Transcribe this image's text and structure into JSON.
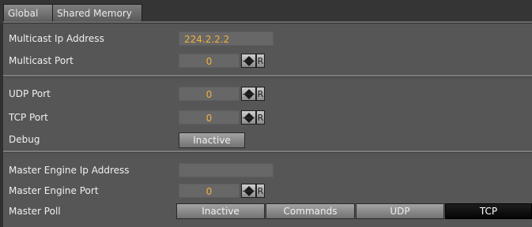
{
  "tabs": [
    {
      "label": "Global"
    },
    {
      "label": "Shared Memory"
    }
  ],
  "section1": {
    "multicast_ip_label": "Multicast Ip Address",
    "multicast_ip_value": "224.2.2.2",
    "multicast_port_label": "Multicast Port",
    "multicast_port_value": "0"
  },
  "section2": {
    "udp_port_label": "UDP Port",
    "udp_port_value": "0",
    "tcp_port_label": "TCP Port",
    "tcp_port_value": "0",
    "debug_label": "Debug",
    "debug_button": "Inactive"
  },
  "section3": {
    "master_ip_label": "Master Engine Ip Address",
    "master_ip_value": "",
    "master_port_label": "Master Engine Port",
    "master_port_value": "0",
    "master_poll_label": "Master Poll",
    "master_poll_options": [
      "Inactive",
      "Commands",
      "UDP",
      "TCP"
    ],
    "master_poll_selected": "TCP"
  },
  "reset_label": "R",
  "colors": {
    "value_text": "#f4b03c",
    "panel_bg": "#555555",
    "active_button": "#0a0a0a"
  },
  "icons": [
    "spin-up-down-icon",
    "reset-icon"
  ]
}
